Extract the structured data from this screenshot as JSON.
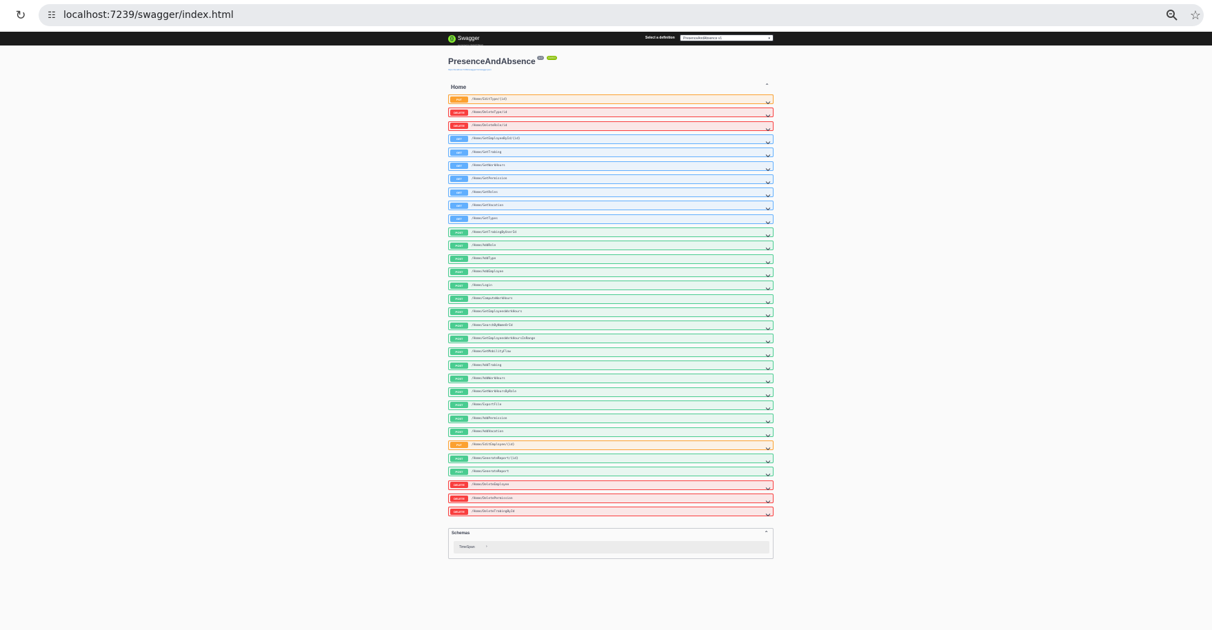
{
  "browser": {
    "url": "localhost:7239/swagger/index.html"
  },
  "topbar": {
    "logo_text": "Swagger",
    "logo_sub": "supported by SMARTBEAR",
    "select_label": "Select a definition",
    "selected_definition": "PresenceAndAbsence v1"
  },
  "info": {
    "title": "PresenceAndAbsence",
    "version_badge": "1.0",
    "oas_badge": "OAS3",
    "spec_url": "https://localhost:7239/swagger/v1/swagger.json"
  },
  "tag": {
    "name": "Home"
  },
  "operations": [
    {
      "method": "PUT",
      "path": "/Home/EditType/{id}"
    },
    {
      "method": "DELETE",
      "path": "/Home/DeleteType/id"
    },
    {
      "method": "DELETE",
      "path": "/Home/DeleteRole/id"
    },
    {
      "method": "GET",
      "path": "/Home/GetEmployeeById/{id}"
    },
    {
      "method": "GET",
      "path": "/Home/GetTrabing"
    },
    {
      "method": "GET",
      "path": "/Home/GetWorkHours"
    },
    {
      "method": "GET",
      "path": "/Home/GetPermission"
    },
    {
      "method": "GET",
      "path": "/Home/GetRoles"
    },
    {
      "method": "GET",
      "path": "/Home/GetVacation"
    },
    {
      "method": "GET",
      "path": "/Home/GetTypes"
    },
    {
      "method": "POST",
      "path": "/Home/GetTrabingByUserId"
    },
    {
      "method": "POST",
      "path": "/Home/AddRole"
    },
    {
      "method": "POST",
      "path": "/Home/AddType"
    },
    {
      "method": "POST",
      "path": "/Home/AddEmployee"
    },
    {
      "method": "POST",
      "path": "/Home/Login"
    },
    {
      "method": "POST",
      "path": "/Home/ComputeWorkHours"
    },
    {
      "method": "POST",
      "path": "/Home/GetEmployeesWorkHours"
    },
    {
      "method": "POST",
      "path": "/Home/SearchByNameOrId"
    },
    {
      "method": "POST",
      "path": "/Home/GetEmployeesWorkHoursInRange"
    },
    {
      "method": "POST",
      "path": "/Home/GetMobilityFlow"
    },
    {
      "method": "POST",
      "path": "/Home/AddTrabing"
    },
    {
      "method": "POST",
      "path": "/Home/AddWorkHours"
    },
    {
      "method": "POST",
      "path": "/Home/GetWorkHoursByRole"
    },
    {
      "method": "POST",
      "path": "/Home/ExportFile"
    },
    {
      "method": "POST",
      "path": "/Home/AddPermission"
    },
    {
      "method": "POST",
      "path": "/Home/AddVacation"
    },
    {
      "method": "PUT",
      "path": "/Home/EditEmployee/{id}"
    },
    {
      "method": "POST",
      "path": "/Home/GenerateReport/{id}"
    },
    {
      "method": "POST",
      "path": "/Home/GenerateReport"
    },
    {
      "method": "DELETE",
      "path": "/Home/DeleteEmployee"
    },
    {
      "method": "DELETE",
      "path": "/Home/DeletePermission"
    },
    {
      "method": "DELETE",
      "path": "/Home/DeleteTrabingById"
    }
  ],
  "schemas": {
    "title": "Schemas",
    "models": [
      "TimeSpan"
    ]
  },
  "colors": {
    "get": "#61affe",
    "post": "#49cc90",
    "put": "#fca130",
    "delete": "#f93e3e"
  },
  "icons": [
    "reload-icon",
    "site-info-icon",
    "zoom-icon",
    "star-icon",
    "chevron-down-icon",
    "chevron-up-icon"
  ]
}
